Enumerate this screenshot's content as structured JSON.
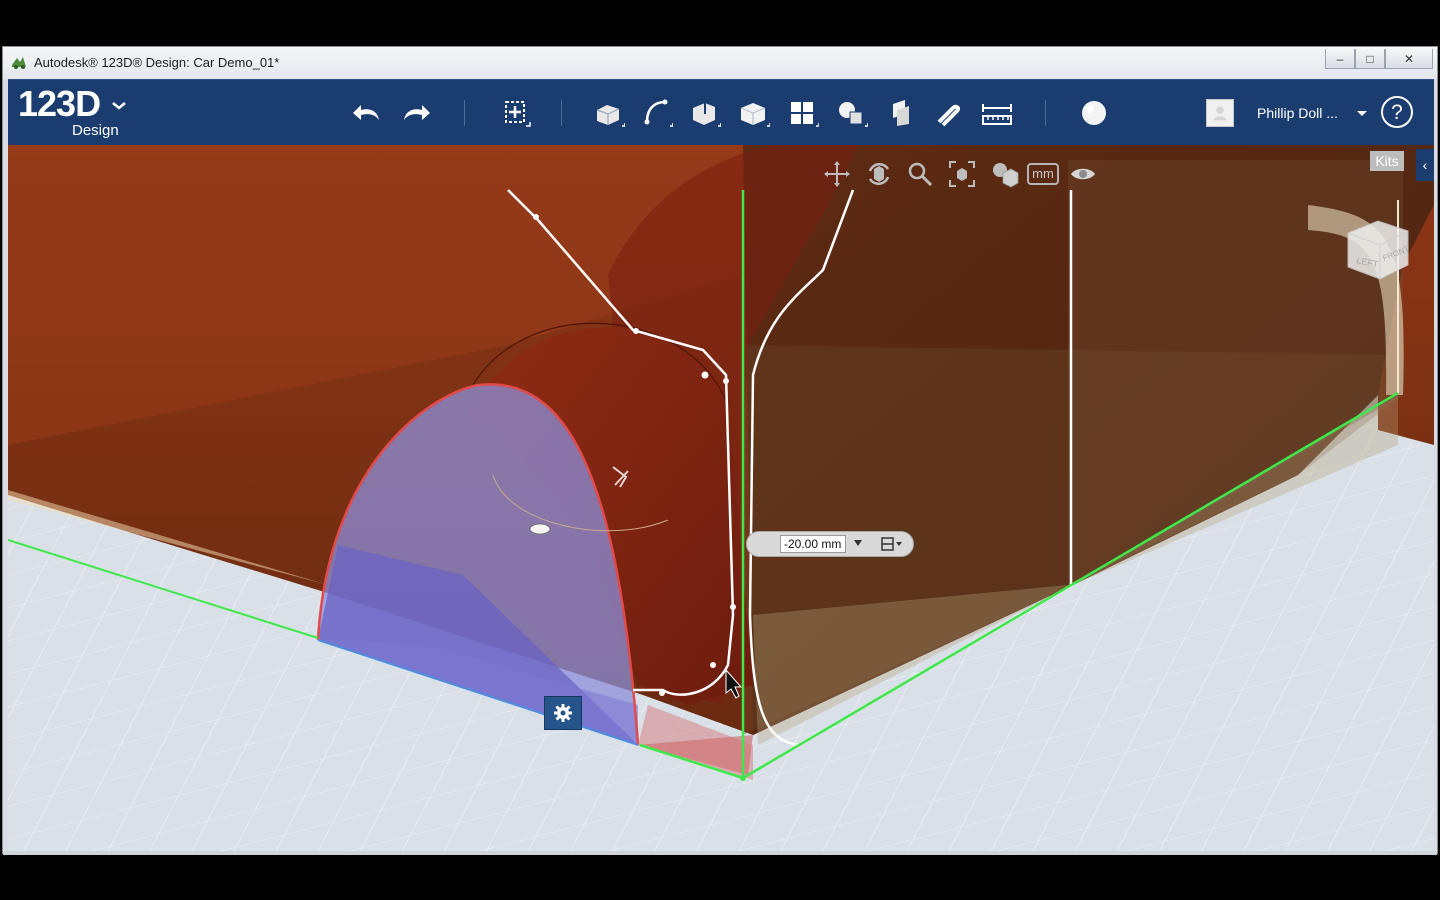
{
  "window": {
    "title": "Autodesk® 123D® Design: Car Demo_01*",
    "controls": {
      "minimize": "–",
      "maximize": "□",
      "close": "✕"
    }
  },
  "toolbar": {
    "logo_main": "123D",
    "logo_sub": "Design",
    "tools": [
      "undo-icon",
      "redo-icon",
      "transform-icon",
      "primitives-icon",
      "sketch-icon",
      "construct-icon",
      "modify-icon",
      "pattern-icon",
      "group-icon",
      "combine-icon",
      "snap-icon",
      "measure-icon",
      "material-icon"
    ],
    "user_name": "Phillip Doll ...",
    "help_label": "?"
  },
  "viewport": {
    "nav_tools": [
      "pan-icon",
      "orbit-icon",
      "zoom-icon",
      "fit-icon",
      "view-mode-icon"
    ],
    "units_label": "mm",
    "kits_label": "Kits",
    "collapse_label": "‹",
    "viewcube_faces": {
      "left": "LEFT",
      "front": "FRONT"
    },
    "dimension_value": "-20.00 mm"
  },
  "colors": {
    "toolbar_bg": "#1b3c6e",
    "body_red": "#8b2a14",
    "selection_blue": "#6a63c4",
    "axis_green": "#3fe84a",
    "grid_bg": "#d8dfe6"
  }
}
